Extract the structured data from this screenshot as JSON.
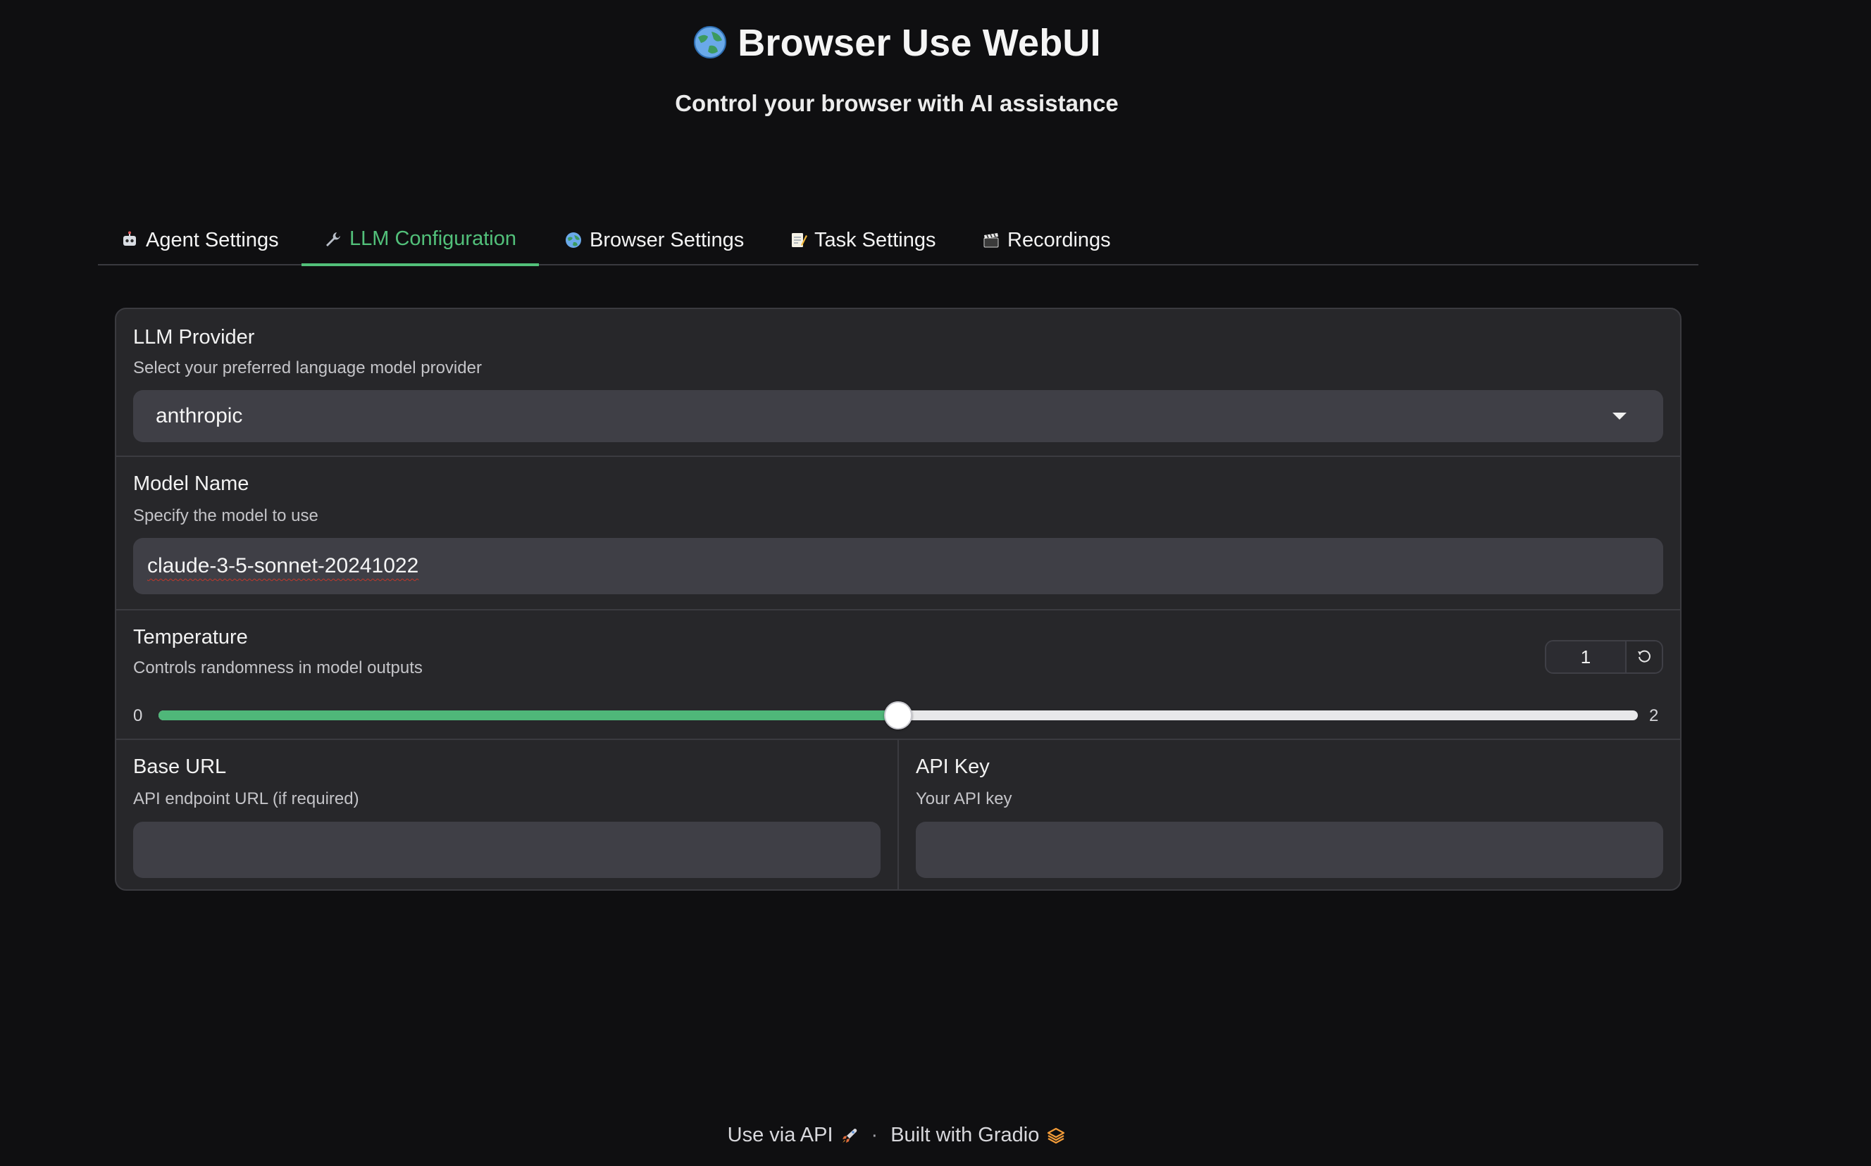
{
  "header": {
    "title": "Browser Use WebUI",
    "subtitle": "Control your browser with AI assistance"
  },
  "tabs": [
    {
      "label": "Agent Settings",
      "icon": "robot-icon"
    },
    {
      "label": "LLM Configuration",
      "icon": "wrench-icon",
      "active": true
    },
    {
      "label": "Browser Settings",
      "icon": "globe-icon"
    },
    {
      "label": "Task Settings",
      "icon": "memo-icon"
    },
    {
      "label": "Recordings",
      "icon": "clapper-icon"
    }
  ],
  "llm_provider": {
    "label": "LLM Provider",
    "info": "Select your preferred language model provider",
    "value": "anthropic"
  },
  "model_name": {
    "label": "Model Name",
    "info": "Specify the model to use",
    "value": "claude-3-5-sonnet-20241022"
  },
  "temperature": {
    "label": "Temperature",
    "info": "Controls randomness in model outputs",
    "value": "1",
    "min": "0",
    "max": "2",
    "fraction": 0.5
  },
  "base_url": {
    "label": "Base URL",
    "info": "API endpoint URL (if required)",
    "value": ""
  },
  "api_key": {
    "label": "API Key",
    "info": "Your API key",
    "value": ""
  },
  "footer": {
    "api_link": "Use via API",
    "separator": "·",
    "gradio_link": "Built with Gradio"
  },
  "colors": {
    "accent": "#52c07a",
    "background": "#0f0f11",
    "panel": "#27272a"
  }
}
